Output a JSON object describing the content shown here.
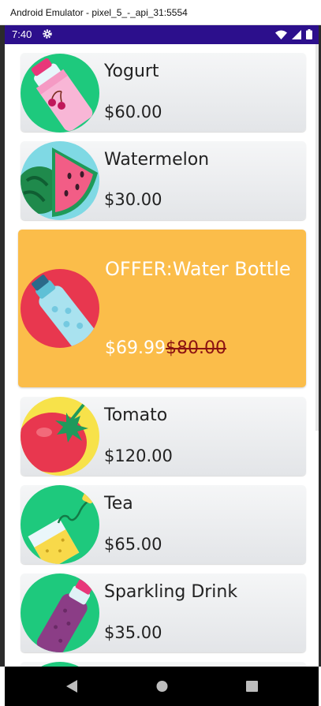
{
  "window": {
    "title": "Android Emulator - pixel_5_-_api_31:5554"
  },
  "status_bar": {
    "time": "7:40"
  },
  "products": [
    {
      "name": "Yogurt",
      "price": "$60.00",
      "icon": "yogurt-icon",
      "bg": "#1ec97d"
    },
    {
      "name": "Watermelon",
      "price": "$30.00",
      "icon": "watermelon-icon",
      "bg": "#7fd9e4"
    },
    {
      "name": "Tomato",
      "price": "$120.00",
      "icon": "tomato-icon",
      "bg": "#f7e24a"
    },
    {
      "name": "Tea",
      "price": "$65.00",
      "icon": "tea-icon",
      "bg": "#1ec97d"
    },
    {
      "name": "Sparkling Drink",
      "price": "$35.00",
      "icon": "sparkling-drink-icon",
      "bg": "#1ec97d"
    }
  ],
  "offer": {
    "label": "OFFER:Water Bottle",
    "price": "$69.99",
    "old_price": "$80.00",
    "icon": "water-bottle-icon",
    "bg": "#e8374f"
  },
  "colors": {
    "status_bar": "#2c0f8c",
    "offer_card": "#fbbd4a",
    "old_price": "#8b1212"
  }
}
